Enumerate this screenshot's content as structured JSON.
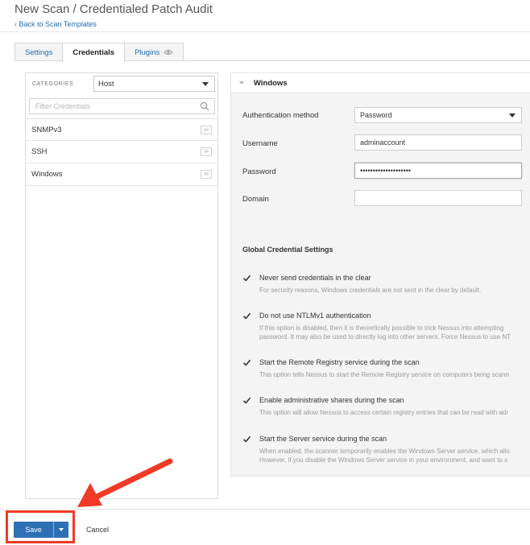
{
  "header": {
    "title": "New Scan / Credentialed Patch Audit",
    "back_link": "‹ Back to Scan Templates"
  },
  "tabs": [
    {
      "label": "Settings",
      "active": false
    },
    {
      "label": "Credentials",
      "active": true
    },
    {
      "label": "Plugins",
      "active": false,
      "icon": "eye-icon"
    }
  ],
  "categories": {
    "label": "CATEGORIES",
    "selected": "Host"
  },
  "filter": {
    "placeholder": "Filter Credentials",
    "value": ""
  },
  "credential_types": [
    {
      "label": "SNMPv3",
      "badge": "∞"
    },
    {
      "label": "SSH",
      "badge": "∞"
    },
    {
      "label": "Windows",
      "badge": "∞"
    }
  ],
  "windows": {
    "title": "Windows",
    "auth_method_label": "Authentication method",
    "auth_method_value": "Password",
    "username_label": "Username",
    "username_value": "adminaccount",
    "password_label": "Password",
    "password_value": "••••••••••••••••••••",
    "domain_label": "Domain",
    "domain_value": ""
  },
  "global": {
    "title": "Global Credential Settings",
    "options": [
      {
        "label": "Never send credentials in the clear",
        "checked": true,
        "desc": [
          "For security reasons, Windows credentials are not sent in the clear by default."
        ]
      },
      {
        "label": "Do not use NTLMv1 authentication",
        "checked": true,
        "desc": [
          "If this option is disabled, then it is theoretically possible to trick Nessus into attempting",
          "password. It may also be used to directly log into other servers. Force Nessus to use NT"
        ]
      },
      {
        "label": "Start the Remote Registry service during the scan",
        "checked": true,
        "desc": [
          "This option tells Nessus to start the Remote Registry service on computers being scann"
        ]
      },
      {
        "label": "Enable administrative shares during the scan",
        "checked": true,
        "desc": [
          "This option will allow Nessus to access certain registry entries that can be read with adr"
        ]
      },
      {
        "label": "Start the Server service during the scan",
        "checked": true,
        "desc": [
          "When enabled, the scanner temporarily enables the Windows Server service, which allo",
          "However, if you disable the Windows Server service in your environment, and want to s"
        ]
      }
    ]
  },
  "footer": {
    "save_label": "Save",
    "cancel_label": "Cancel"
  },
  "annotation_color": "#f03a26",
  "accent_color": "#2e70b5"
}
